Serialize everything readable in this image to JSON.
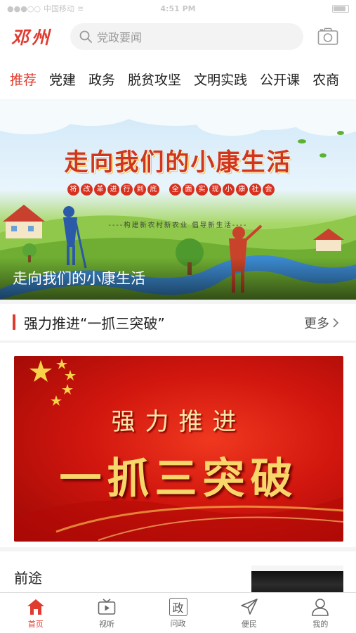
{
  "status_bar": {
    "carrier": "中国移动",
    "time": "4:51 PM"
  },
  "header": {
    "logo": "邓州",
    "search_placeholder": "党政要闻"
  },
  "tabs": [
    {
      "label": "推荐",
      "active": true
    },
    {
      "label": "党建"
    },
    {
      "label": "政务"
    },
    {
      "label": "脱贫攻坚"
    },
    {
      "label": "文明实践"
    },
    {
      "label": "公开课"
    },
    {
      "label": "农商"
    }
  ],
  "hero": {
    "banner_title": "走向我们的小康生活",
    "ribbon_chars": [
      "将",
      "改",
      "革",
      "进",
      "行",
      "到",
      "底"
    ],
    "ribbon_chars2": [
      "全",
      "面",
      "实",
      "现",
      "小",
      "康",
      "社",
      "会"
    ],
    "subtitle": "----构建新农村新农业 倡导新生活----",
    "caption": "走向我们的小康生活"
  },
  "section": {
    "title": "强力推进“一抓三突破”",
    "more": "更多"
  },
  "promo": {
    "line1": "强力推进",
    "line2": "一抓三突破"
  },
  "list": {
    "title": "前途"
  },
  "bottom_nav": [
    {
      "label": "首页",
      "icon": "home-icon",
      "active": true
    },
    {
      "label": "视听",
      "icon": "tv-icon"
    },
    {
      "label": "问政",
      "icon": "zheng-icon",
      "glyph": "政"
    },
    {
      "label": "便民",
      "icon": "send-icon"
    },
    {
      "label": "我的",
      "icon": "user-icon"
    }
  ],
  "colors": {
    "accent": "#e03b2f",
    "nav_inactive": "#666666"
  }
}
